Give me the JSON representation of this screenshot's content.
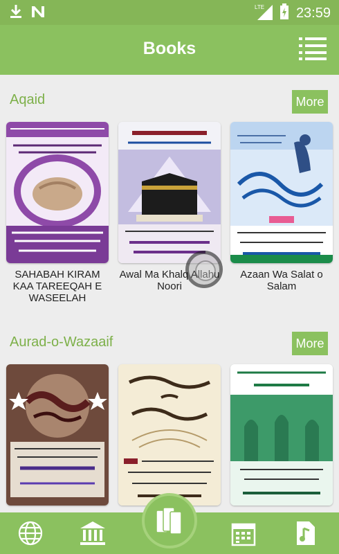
{
  "status_bar": {
    "time": "23:59",
    "network": "LTE"
  },
  "app_bar": {
    "title": "Books"
  },
  "sections": [
    {
      "title": "Aqaid",
      "more_label": "More",
      "books": [
        {
          "title": "SAHABAH KIRAM KAA TAREEQAH E WASEELAH"
        },
        {
          "title": "Awal Ma Khalq Allahu Noori"
        },
        {
          "title": "Azaan Wa Salat o Salam"
        }
      ]
    },
    {
      "title": "Aurad-o-Wazaaif",
      "more_label": "More",
      "books": [
        {
          "title": ""
        },
        {
          "title": ""
        },
        {
          "title": ""
        }
      ]
    }
  ],
  "bottom_nav": [
    "globe-icon",
    "library-icon",
    "books-icon",
    "calendar-icon",
    "music-note-icon"
  ],
  "colors": {
    "primary": "#8bc15f",
    "accent_text": "#7db049",
    "background": "#ededed"
  }
}
